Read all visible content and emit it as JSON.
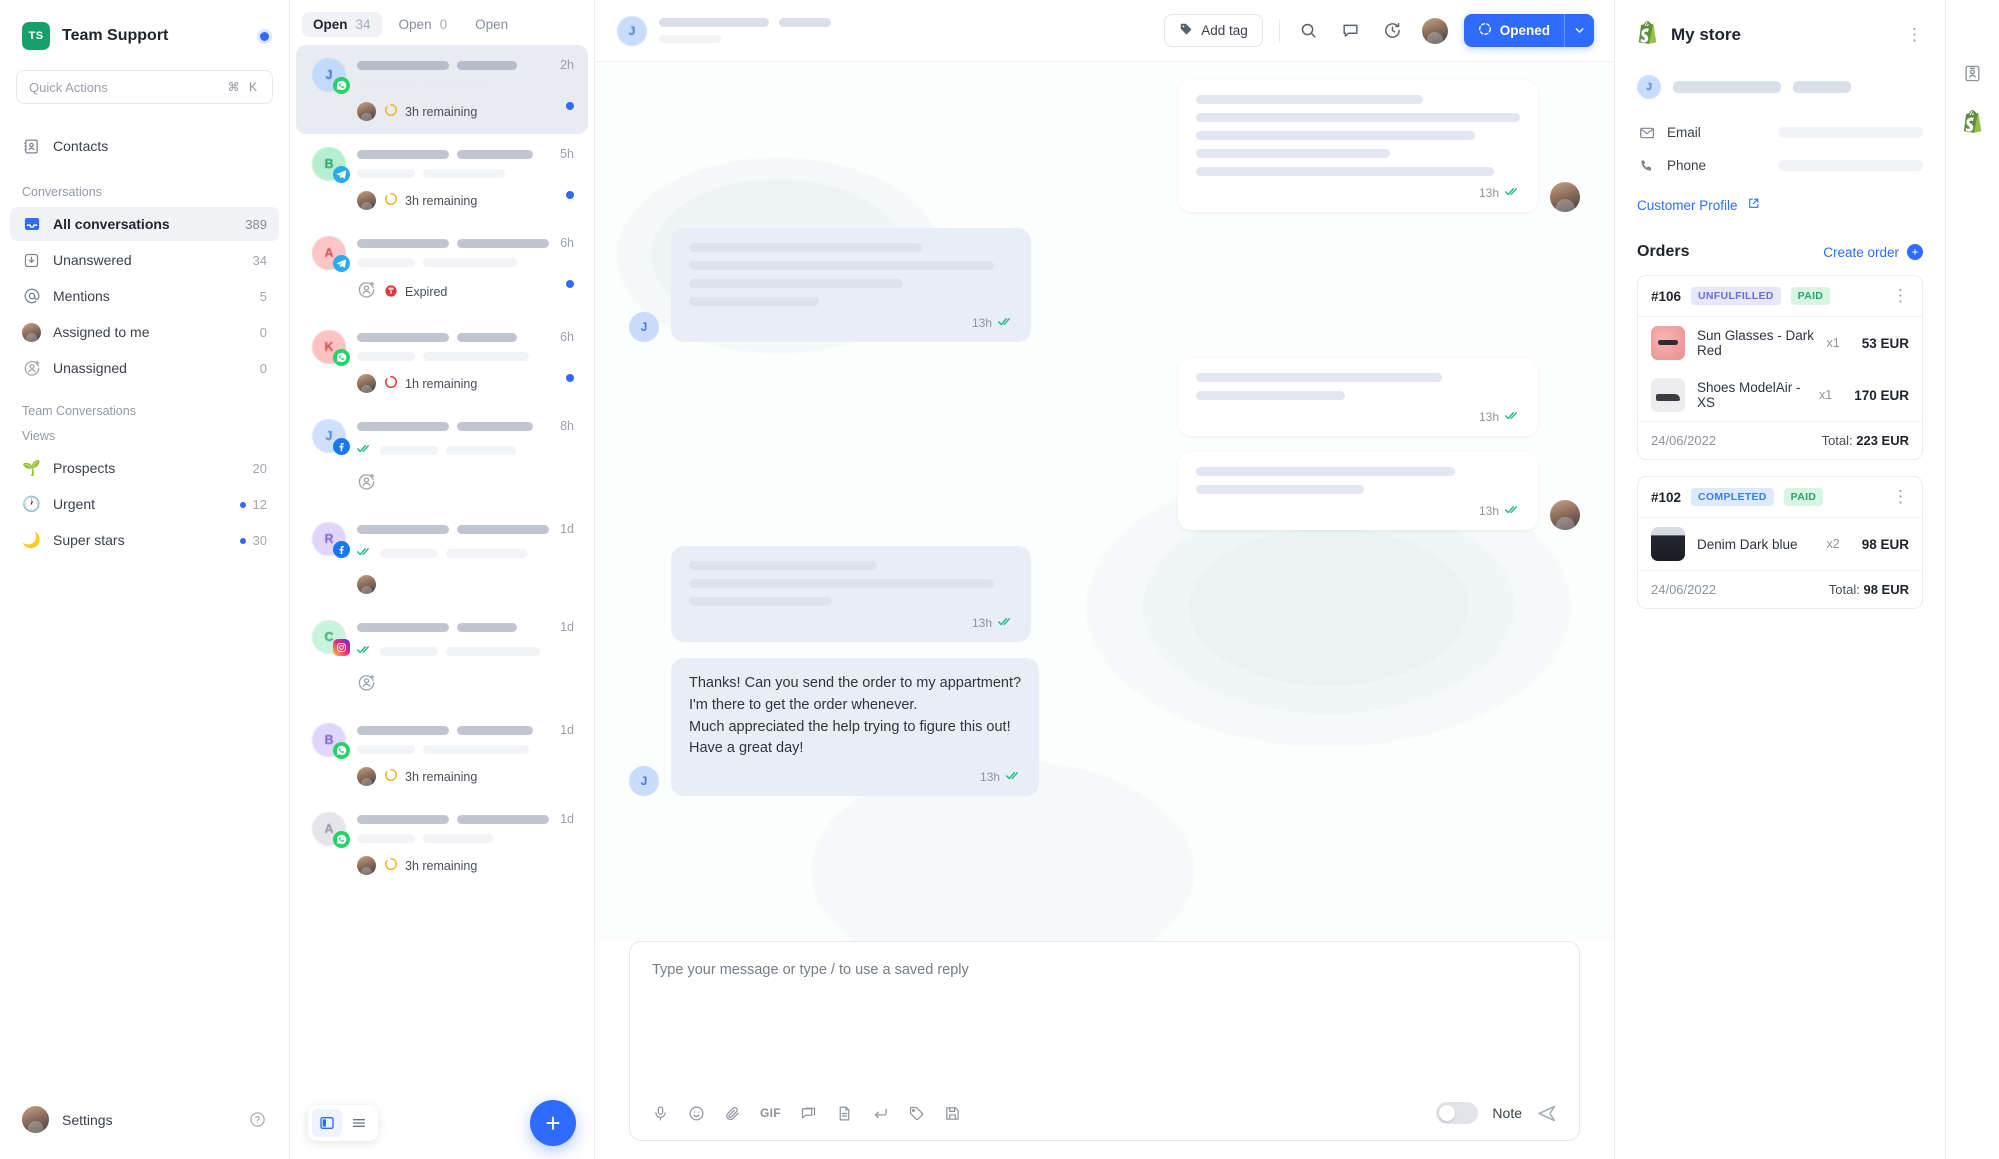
{
  "brand": {
    "logo_text": "TS",
    "name": "Team Support"
  },
  "quick_actions": {
    "placeholder": "Quick Actions",
    "shortcut": "⌘ K"
  },
  "sidebar": {
    "contacts_label": "Contacts",
    "conversations_label": "Conversations",
    "team_conversations_label": "Team Conversations",
    "views_label": "Views",
    "conversations": [
      {
        "label": "All conversations",
        "count": "389",
        "icon": "inbox-icon",
        "active": true
      },
      {
        "label": "Unanswered",
        "count": "34",
        "icon": "download-box-icon",
        "active": false
      },
      {
        "label": "Mentions",
        "count": "5",
        "icon": "at-icon",
        "active": false
      },
      {
        "label": "Assigned to me",
        "count": "0",
        "icon": "avatar-icon",
        "active": false
      },
      {
        "label": "Unassigned",
        "count": "0",
        "icon": "unassigned-icon",
        "active": false
      }
    ],
    "views": [
      {
        "label": "Prospects",
        "count": "20",
        "emoji": "🌱",
        "dot": false
      },
      {
        "label": "Urgent",
        "count": "12",
        "emoji": "🕐",
        "dot": true
      },
      {
        "label": "Super stars",
        "count": "30",
        "emoji": "🌙",
        "dot": true
      }
    ],
    "footer": {
      "settings_label": "Settings"
    }
  },
  "conversation_list": {
    "tabs": [
      {
        "label": "Open",
        "count": "34",
        "active": true
      },
      {
        "label": "Open",
        "count": "0",
        "active": false
      },
      {
        "label": "Open",
        "count": "",
        "active": false
      }
    ],
    "rows": [
      {
        "initial": "J",
        "av_bg": "#c3dafc",
        "av_fg": "#3e6fbe",
        "channel": "wa",
        "time": "2h",
        "unread": true,
        "selected": true,
        "sla": "3h remaining",
        "sla_state": "warn",
        "meta_icon": "agent-avatar",
        "ticks": false
      },
      {
        "initial": "B",
        "av_bg": "#b4f0cf",
        "av_fg": "#1f9d63",
        "channel": "tg",
        "time": "5h",
        "unread": true,
        "selected": false,
        "sla": "3h remaining",
        "sla_state": "warn",
        "meta_icon": "agent-avatar",
        "ticks": false
      },
      {
        "initial": "A",
        "av_bg": "#fcc6c6",
        "av_fg": "#d2464b",
        "channel": "tg",
        "time": "6h",
        "unread": true,
        "selected": false,
        "sla": "Expired",
        "sla_state": "expired",
        "meta_icon": "unassigned-icon",
        "ticks": false
      },
      {
        "initial": "K",
        "av_bg": "#fcc2c2",
        "av_fg": "#d2464b",
        "channel": "wa",
        "time": "6h",
        "unread": true,
        "selected": false,
        "sla": "1h remaining",
        "sla_state": "danger",
        "meta_icon": "agent-avatar",
        "ticks": false
      },
      {
        "initial": "J",
        "av_bg": "#cfe0fb",
        "av_fg": "#4a79c8",
        "channel": "fb",
        "time": "8h",
        "unread": false,
        "selected": false,
        "sla": "",
        "sla_state": "none",
        "meta_icon": "unassigned-icon",
        "ticks": true
      },
      {
        "initial": "R",
        "av_bg": "#e0d6fb",
        "av_fg": "#7a5ad2",
        "channel": "fb",
        "time": "1d",
        "unread": false,
        "selected": false,
        "sla": "",
        "sla_state": "none",
        "meta_icon": "agent-avatar",
        "ticks": true
      },
      {
        "initial": "C",
        "av_bg": "#c8f3dc",
        "av_fg": "#2aa36b",
        "channel": "ig",
        "time": "1d",
        "unread": false,
        "selected": false,
        "sla": "",
        "sla_state": "none",
        "meta_icon": "unassigned-icon",
        "ticks": true
      },
      {
        "initial": "B",
        "av_bg": "#e0d6fb",
        "av_fg": "#7a5ad2",
        "channel": "wa",
        "time": "1d",
        "unread": false,
        "selected": false,
        "sla": "3h remaining",
        "sla_state": "warn",
        "meta_icon": "agent-avatar",
        "ticks": false
      },
      {
        "initial": "A",
        "av_bg": "#e5e5ea",
        "av_fg": "#8d939f",
        "channel": "wa",
        "time": "1d",
        "unread": false,
        "selected": false,
        "sla": "3h remaining",
        "sla_state": "warn",
        "meta_icon": "agent-avatar",
        "ticks": false
      }
    ],
    "footer": {
      "panel_view_icon": "panel-view-icon",
      "list_view_icon": "list-view-icon",
      "new_conversation_label": "+"
    }
  },
  "chat": {
    "header": {
      "contact_initial": "J",
      "add_tag_label": "Add tag",
      "search_icon": "search-icon",
      "comment_icon": "comment-icon",
      "history_icon": "history-icon",
      "status_label": "Opened"
    },
    "messages": [
      {
        "side": "out",
        "type": "skeleton",
        "style": "white",
        "lines": [
          70,
          100,
          86,
          60,
          92
        ],
        "time": "13h",
        "ticks": true,
        "avatar": "agent-photo"
      },
      {
        "side": "in",
        "type": "skeleton",
        "style": "blue",
        "lines": [
          72,
          94,
          66,
          40
        ],
        "time": "13h",
        "ticks": true,
        "avatar": "J"
      },
      {
        "side": "out",
        "type": "skeleton",
        "style": "white",
        "lines": [
          76,
          46
        ],
        "time": "13h",
        "ticks": true,
        "avatar": "none"
      },
      {
        "side": "out",
        "type": "skeleton",
        "style": "white",
        "lines": [
          80,
          52
        ],
        "time": "13h",
        "ticks": true,
        "avatar": "agent-photo"
      },
      {
        "side": "in",
        "type": "skeleton",
        "style": "blue",
        "lines": [
          58,
          94,
          44
        ],
        "time": "13h",
        "ticks": true,
        "avatar": "none"
      },
      {
        "side": "in",
        "type": "text",
        "style": "blue",
        "text": "Thanks! Can you send the order to my appartment?\nI'm there to get the order whenever.\nMuch appreciated the help trying to figure this out!\nHave a great day!",
        "time": "13h",
        "ticks": true,
        "avatar": "J"
      }
    ],
    "composer": {
      "placeholder": "Type your message or type / to use a saved reply",
      "note_label": "Note",
      "tools": [
        {
          "icon": "microphone-icon"
        },
        {
          "icon": "emoji-icon"
        },
        {
          "icon": "attachment-icon"
        },
        {
          "icon": "gif-icon",
          "label": "GIF"
        },
        {
          "icon": "saved-reply-icon"
        },
        {
          "icon": "document-icon"
        },
        {
          "icon": "enter-key-icon"
        },
        {
          "icon": "tag-icon"
        },
        {
          "icon": "save-icon"
        }
      ],
      "send_icon": "send-icon"
    }
  },
  "right_panel": {
    "store_name": "My store",
    "store_icon": "shopify-icon",
    "customer_initial": "J",
    "fields": [
      {
        "label": "Email",
        "icon": "email-icon"
      },
      {
        "label": "Phone",
        "icon": "phone-icon"
      }
    ],
    "customer_profile_label": "Customer Profile",
    "orders_title": "Orders",
    "create_order_label": "Create order",
    "orders": [
      {
        "number": "#106",
        "badges": [
          {
            "text": "UNFULFILLED",
            "kind": "unf"
          },
          {
            "text": "PAID",
            "kind": "paid"
          }
        ],
        "items": [
          {
            "name": "Sun Glasses - Dark Red",
            "qty": "x1",
            "price": "53 EUR",
            "thumb": "th-sun"
          },
          {
            "name": "Shoes ModelAir - XS",
            "qty": "x1",
            "price": "170 EUR",
            "thumb": "th-shoe"
          }
        ],
        "date": "24/06/2022",
        "total_label": "Total:",
        "total": "223 EUR"
      },
      {
        "number": "#102",
        "badges": [
          {
            "text": "COMPLETED",
            "kind": "com"
          },
          {
            "text": "PAID",
            "kind": "paid"
          }
        ],
        "items": [
          {
            "name": "Denim Dark blue",
            "qty": "x2",
            "price": "98 EUR",
            "thumb": "th-denim"
          }
        ],
        "date": "24/06/2022",
        "total_label": "Total:",
        "total": "98 EUR"
      }
    ]
  },
  "right_rail": {
    "items": [
      {
        "icon": "contact-card-icon"
      },
      {
        "icon": "shopify-icon"
      }
    ]
  },
  "colors": {
    "accent": "#2f6bff",
    "brand_green": "#16a06a",
    "paid": "#2aa36b",
    "danger": "#e0323c",
    "warn": "#f0b429"
  }
}
